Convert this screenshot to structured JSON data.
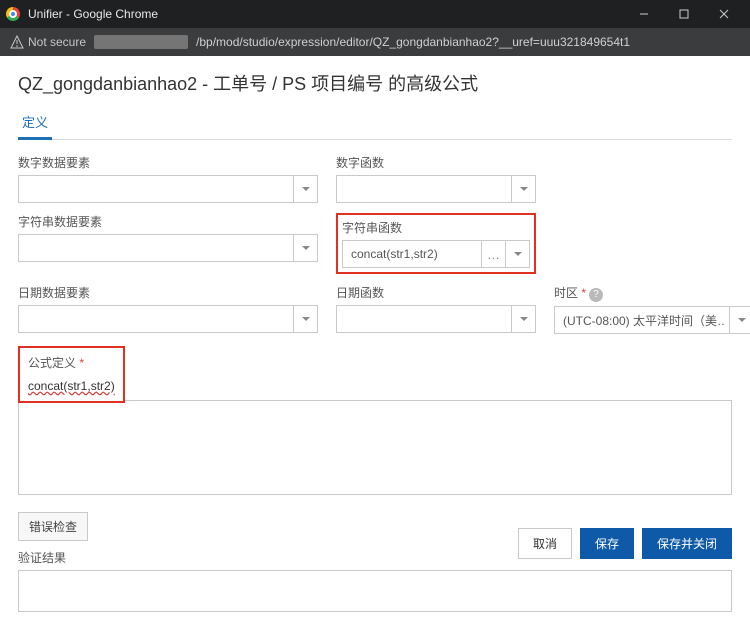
{
  "window": {
    "title": "Unifier - Google Chrome",
    "not_secure": "Not secure",
    "url_path": "/bp/mod/studio/expression/editor/QZ_gongdanbianhao2?__uref=uuu321849654t1"
  },
  "page": {
    "title": "QZ_gongdanbianhao2 - 工单号 / PS 项目编号 的高级公式"
  },
  "tabs": {
    "definition": "定义"
  },
  "fields": {
    "numeric_element": {
      "label": "数字数据要素",
      "value": ""
    },
    "numeric_func": {
      "label": "数字函数",
      "value": ""
    },
    "string_element": {
      "label": "字符串数据要素",
      "value": ""
    },
    "string_func": {
      "label": "字符串函数",
      "value": "concat(str1,str2)"
    },
    "date_element": {
      "label": "日期数据要素",
      "value": ""
    },
    "date_func": {
      "label": "日期函数",
      "value": ""
    },
    "timezone": {
      "label": "时区",
      "value": "(UTC-08:00) 太平洋时间（美…"
    }
  },
  "formula": {
    "label": "公式定义",
    "value": "concat(str1,str2)"
  },
  "errcheck": {
    "button": "错误检查",
    "label": "验证结果"
  },
  "footer": {
    "cancel": "取消",
    "save": "保存",
    "save_close": "保存并关闭"
  }
}
